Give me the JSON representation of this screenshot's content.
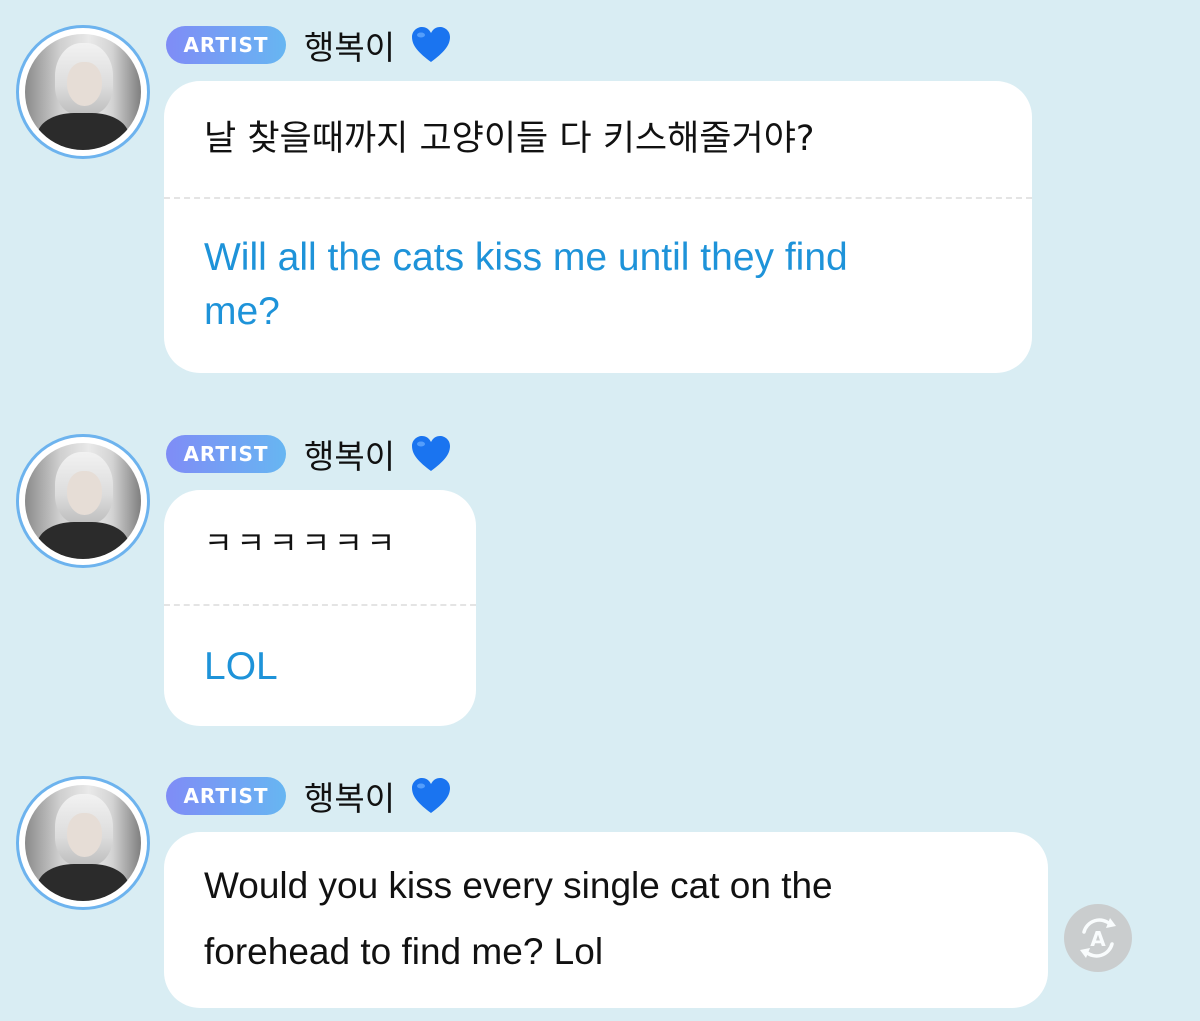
{
  "messages": [
    {
      "badge": "ARTIST",
      "username": "행복이",
      "text": "날 찾을때까지 고양이들 다 키스해줄거야?",
      "translation_line1": "Will all the cats kiss me until they find",
      "translation_line2": "me?"
    },
    {
      "badge": "ARTIST",
      "username": "행복이",
      "text": "ㅋㅋㅋㅋㅋㅋ",
      "translation": "LOL"
    },
    {
      "badge": "ARTIST",
      "username": "행복이",
      "text_line1": "Would you kiss every single cat on the",
      "text_line2": "forehead to find me? Lol"
    }
  ],
  "icons": {
    "heart": "blue-heart-icon",
    "translate": "auto-translate-icon"
  },
  "colors": {
    "background": "#d9edf3",
    "badge_start": "#7f8cf6",
    "badge_end": "#67b6f2",
    "translation_text": "#1e93d9",
    "heart": "#1a74f0"
  }
}
